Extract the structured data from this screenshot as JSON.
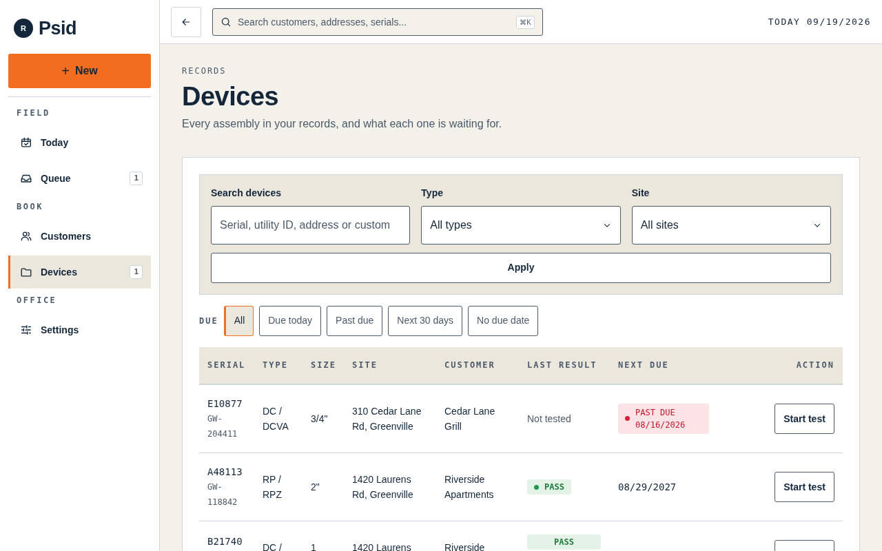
{
  "brand": {
    "name": "Psid",
    "mark": "R"
  },
  "new_button": {
    "icon": "+",
    "label": "New"
  },
  "sidebar": {
    "sections": [
      {
        "heading": "FIELD",
        "items": [
          {
            "label": "Today",
            "selected": false
          },
          {
            "label": "Queue",
            "count": "1",
            "selected": false
          }
        ]
      },
      {
        "heading": "BOOK",
        "items": [
          {
            "label": "Customers",
            "selected": false
          },
          {
            "label": "Devices",
            "count": "1",
            "selected": true
          }
        ]
      },
      {
        "heading": "OFFICE",
        "items": [
          {
            "label": "Settings",
            "selected": false
          }
        ]
      }
    ]
  },
  "topbar": {
    "search_placeholder": "Search customers, addresses, serials...",
    "shortcut": "⌘K",
    "date": "TODAY 09/19/2026"
  },
  "page": {
    "eyebrow": "RECORDS",
    "title": "Devices",
    "subtitle": "Every assembly in your records, and what each one is waiting for."
  },
  "filters": {
    "search": {
      "label": "Search devices",
      "placeholder": "Serial, utility ID, address or custom"
    },
    "type": {
      "label": "Type",
      "value": "All types"
    },
    "site": {
      "label": "Site",
      "value": "All sites"
    },
    "apply": "Apply"
  },
  "due": {
    "label": "DUE",
    "options": [
      {
        "label": "All",
        "selected": true
      },
      {
        "label": "Due today",
        "selected": false
      },
      {
        "label": "Past due",
        "selected": false
      },
      {
        "label": "Next 30 days",
        "selected": false
      },
      {
        "label": "No due date",
        "selected": false
      }
    ]
  },
  "table": {
    "columns": [
      "SERIAL",
      "TYPE",
      "SIZE",
      "SITE",
      "CUSTOMER",
      "LAST RESULT",
      "NEXT DUE",
      "ACTION"
    ],
    "rows": [
      {
        "serial": "E10877",
        "utility_id": "GW-204411",
        "type": "DC / DCVA",
        "size": "3/4\"",
        "site": "310 Cedar Lane Rd, Greenville",
        "customer": "Cedar Lane Grill",
        "last_result": {
          "kind": "none",
          "text": "Not tested"
        },
        "next_due": {
          "kind": "past_due",
          "text": "PAST DUE 08/16/2026"
        },
        "action": "Start test"
      },
      {
        "serial": "A48113",
        "utility_id": "GW-118842",
        "type": "RP / RPZ",
        "size": "2\"",
        "site": "1420 Laurens Rd, Greenville",
        "customer": "Riverside Apartments",
        "last_result": {
          "kind": "pass",
          "text": "PASS"
        },
        "next_due": {
          "kind": "date",
          "text": "08/29/2027"
        },
        "action": "Start test"
      },
      {
        "serial": "B21740",
        "type": "DC /",
        "size": "1",
        "site": "1420 Laurens",
        "customer": "Riverside",
        "last_result": {
          "kind": "pass_wide",
          "text": "PASS"
        }
      }
    ]
  }
}
